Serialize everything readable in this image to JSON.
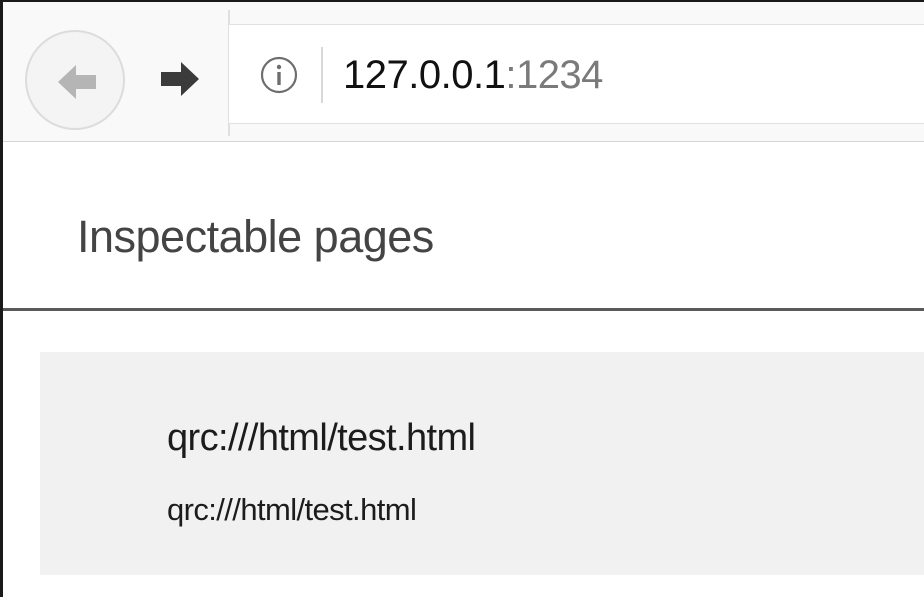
{
  "browser": {
    "back_icon": "back-arrow-icon",
    "forward_icon": "forward-arrow-icon",
    "site_info_icon": "info-icon",
    "url": {
      "host": "127.0.0.1",
      "port": ":1234"
    }
  },
  "page": {
    "title": "Inspectable pages",
    "items": [
      {
        "title": "qrc:///html/test.html",
        "url": "qrc:///html/test.html"
      }
    ]
  },
  "colors": {
    "toolbar_bg": "#f9f9fa",
    "card_bg": "#f1f1f1",
    "title_text": "#444444",
    "port_text": "#7a7a7a"
  }
}
